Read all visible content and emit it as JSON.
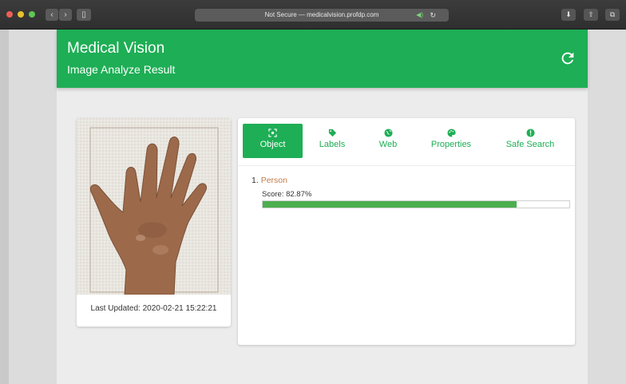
{
  "browser": {
    "url_text": "Not Secure — medicalvision.profdp.com"
  },
  "app": {
    "title": "Medical Vision",
    "subtitle": "Image Analyze Result",
    "accent_color": "#1eae55"
  },
  "image_card": {
    "last_updated": "Last Updated: 2020-02-21 15:22:21"
  },
  "tabs": [
    {
      "label": "Object",
      "icon": "object-detect-icon",
      "active": true
    },
    {
      "label": "Labels",
      "icon": "tag-icon",
      "active": false
    },
    {
      "label": "Web",
      "icon": "globe-icon",
      "active": false
    },
    {
      "label": "Properties",
      "icon": "palette-icon",
      "active": false
    },
    {
      "label": "Safe Search",
      "icon": "alert-circle-icon",
      "active": false
    }
  ],
  "results": [
    {
      "index": "1.",
      "name": "Person",
      "score_text": "Score: 82.87%",
      "score": 0.8287
    }
  ]
}
